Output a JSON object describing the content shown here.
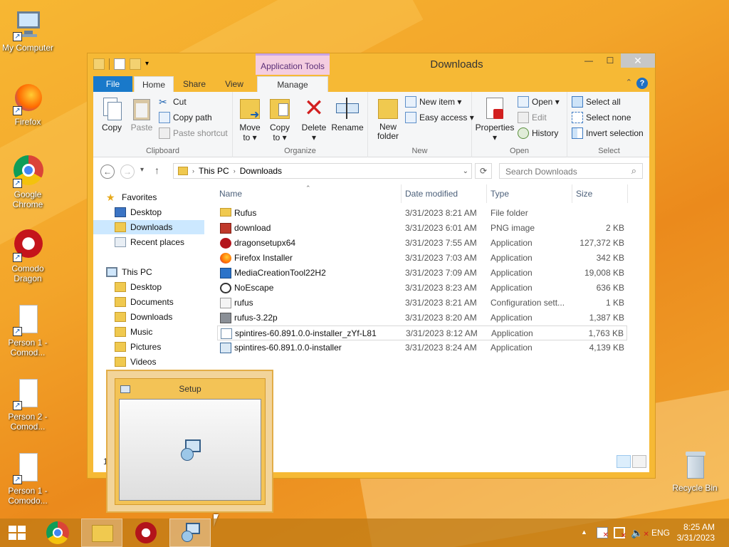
{
  "desktop": {
    "icons": [
      {
        "label": "My Computer",
        "icon": "computer-icon"
      },
      {
        "label": "Firefox",
        "icon": "firefox-icon"
      },
      {
        "label": "Google Chrome",
        "icon": "chrome-icon"
      },
      {
        "label": "Comodo Dragon",
        "icon": "comodo-dragon-icon"
      },
      {
        "label": "Person 1 - Comod...",
        "icon": "document-icon"
      },
      {
        "label": "Person 2 - Comod...",
        "icon": "document-icon"
      },
      {
        "label": "Person 1 - Comodo...",
        "icon": "document-icon"
      },
      {
        "label": "Recycle Bin",
        "icon": "recycle-bin-icon"
      }
    ]
  },
  "window": {
    "title": "Downloads",
    "context_tab": "Application Tools",
    "tabs": {
      "file": "File",
      "home": "Home",
      "share": "Share",
      "view": "View",
      "manage": "Manage"
    },
    "controls": {
      "minimize": "—",
      "maximize": "☐",
      "close": "✕"
    }
  },
  "ribbon": {
    "clipboard": {
      "label": "Clipboard",
      "copy": "Copy",
      "paste": "Paste",
      "cut": "Cut",
      "copy_path": "Copy path",
      "paste_shortcut": "Paste shortcut"
    },
    "organize": {
      "label": "Organize",
      "move_to": "Move to ▾",
      "copy_to": "Copy to ▾",
      "delete": "Delete ▾",
      "rename": "Rename"
    },
    "new": {
      "label": "New",
      "new_folder": "New folder",
      "new_item": "New item ▾",
      "easy_access": "Easy access ▾"
    },
    "open": {
      "label": "Open",
      "properties": "Properties ▾",
      "open": "Open ▾",
      "edit": "Edit",
      "history": "History"
    },
    "select": {
      "label": "Select",
      "select_all": "Select all",
      "select_none": "Select none",
      "invert": "Invert selection"
    }
  },
  "address": {
    "path": [
      "This PC",
      "Downloads"
    ],
    "search_placeholder": "Search Downloads"
  },
  "navpane": {
    "favorites": "Favorites",
    "fav_items": [
      "Desktop",
      "Downloads",
      "Recent places"
    ],
    "this_pc": "This PC",
    "pc_items": [
      "Desktop",
      "Documents",
      "Downloads",
      "Music",
      "Pictures",
      "Videos"
    ]
  },
  "filelist": {
    "columns": {
      "name": "Name",
      "date": "Date modified",
      "type": "Type",
      "size": "Size"
    },
    "rows": [
      {
        "name": "Rufus",
        "date": "3/31/2023 8:21 AM",
        "type": "File folder",
        "size": "",
        "icon": "folder-icon"
      },
      {
        "name": "download",
        "date": "3/31/2023 6:01 AM",
        "type": "PNG image",
        "size": "2 KB",
        "icon": "image-file-icon"
      },
      {
        "name": "dragonsetupx64",
        "date": "3/31/2023 7:55 AM",
        "type": "Application",
        "size": "127,372 KB",
        "icon": "dragon-app-icon"
      },
      {
        "name": "Firefox Installer",
        "date": "3/31/2023 7:03 AM",
        "type": "Application",
        "size": "342 KB",
        "icon": "firefox-app-icon"
      },
      {
        "name": "MediaCreationTool22H2",
        "date": "3/31/2023 7:09 AM",
        "type": "Application",
        "size": "19,008 KB",
        "icon": "media-tool-icon"
      },
      {
        "name": "NoEscape",
        "date": "3/31/2023 8:23 AM",
        "type": "Application",
        "size": "636 KB",
        "icon": "noescape-app-icon"
      },
      {
        "name": "rufus",
        "date": "3/31/2023 8:21 AM",
        "type": "Configuration sett...",
        "size": "1 KB",
        "icon": "config-file-icon"
      },
      {
        "name": "rufus-3.22p",
        "date": "3/31/2023 8:20 AM",
        "type": "Application",
        "size": "1,387 KB",
        "icon": "rufus-app-icon"
      },
      {
        "name": "spintires-60.891.0.0-installer_zYf-L81",
        "date": "3/31/2023 8:12 AM",
        "type": "Application",
        "size": "1,763 KB",
        "icon": "installer-icon"
      },
      {
        "name": "spintires-60.891.0.0-installer",
        "date": "3/31/2023 8:24 AM",
        "type": "Application",
        "size": "4,139 KB",
        "icon": "setup-app-icon"
      }
    ],
    "item_count_fragment": "1"
  },
  "setup_preview": {
    "title": "Setup"
  },
  "taskbar": {
    "language": "ENG",
    "time": "8:25 AM",
    "date": "3/31/2023",
    "show_hidden": "▲"
  }
}
